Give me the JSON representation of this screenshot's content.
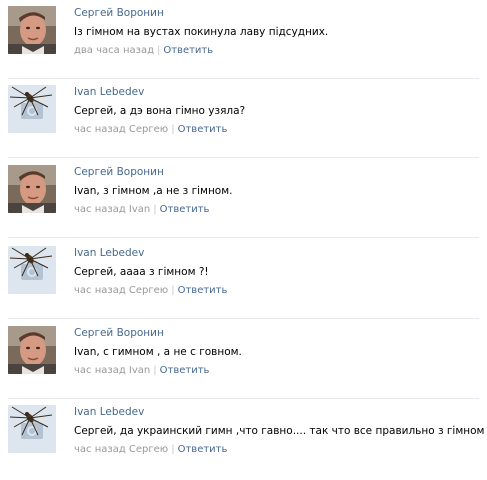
{
  "comments": [
    {
      "author": "Сергей Воронин",
      "avatar": "user-photo",
      "text": "Із гімном на вустах покинула лаву підсудних.",
      "time": "два часа назад",
      "separator": "|",
      "reply": "Ответить"
    },
    {
      "author": "Ivan Lebedev",
      "avatar": "spider-camera-placeholder",
      "text": "Сергей, а дэ вона гімно узяла?",
      "time": "час назад Сергею",
      "separator": "|",
      "reply": "Ответить"
    },
    {
      "author": "Сергей Воронин",
      "avatar": "user-photo",
      "text": "Ivan, з гімном ,а не з гімном.",
      "time": "час назад Ivan",
      "separator": "|",
      "reply": "Ответить"
    },
    {
      "author": "Ivan Lebedev",
      "avatar": "spider-camera-placeholder",
      "text": "Сергей, аааа з гімном ?!",
      "time": "час назад Сергею",
      "separator": "|",
      "reply": "Ответить"
    },
    {
      "author": "Сергей Воронин",
      "avatar": "user-photo",
      "text": "Ivan, с гимном , а не с говном.",
      "time": "час назад Ivan",
      "separator": "|",
      "reply": "Ответить"
    },
    {
      "author": "Ivan Lebedev",
      "avatar": "spider-camera-placeholder",
      "text": "Сергей, да украинский гимн ,что гавно.... так что все правильно з гімном",
      "time": "час назад Сергею",
      "separator": "|",
      "reply": "Ответить"
    }
  ],
  "colors": {
    "author_link": "#45688e",
    "meta_text": "#999999",
    "divider": "#e6e9ee",
    "placeholder_bg": "#dde5ef",
    "camera_icon": "#b4c3d4"
  }
}
